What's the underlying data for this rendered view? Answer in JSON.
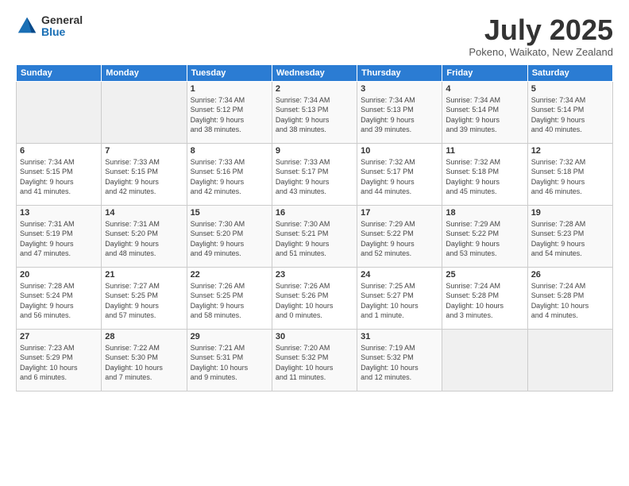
{
  "logo": {
    "general": "General",
    "blue": "Blue"
  },
  "title": "July 2025",
  "subtitle": "Pokeno, Waikato, New Zealand",
  "days_header": [
    "Sunday",
    "Monday",
    "Tuesday",
    "Wednesday",
    "Thursday",
    "Friday",
    "Saturday"
  ],
  "weeks": [
    [
      {
        "day": "",
        "info": ""
      },
      {
        "day": "",
        "info": ""
      },
      {
        "day": "1",
        "info": "Sunrise: 7:34 AM\nSunset: 5:12 PM\nDaylight: 9 hours\nand 38 minutes."
      },
      {
        "day": "2",
        "info": "Sunrise: 7:34 AM\nSunset: 5:13 PM\nDaylight: 9 hours\nand 38 minutes."
      },
      {
        "day": "3",
        "info": "Sunrise: 7:34 AM\nSunset: 5:13 PM\nDaylight: 9 hours\nand 39 minutes."
      },
      {
        "day": "4",
        "info": "Sunrise: 7:34 AM\nSunset: 5:14 PM\nDaylight: 9 hours\nand 39 minutes."
      },
      {
        "day": "5",
        "info": "Sunrise: 7:34 AM\nSunset: 5:14 PM\nDaylight: 9 hours\nand 40 minutes."
      }
    ],
    [
      {
        "day": "6",
        "info": "Sunrise: 7:34 AM\nSunset: 5:15 PM\nDaylight: 9 hours\nand 41 minutes."
      },
      {
        "day": "7",
        "info": "Sunrise: 7:33 AM\nSunset: 5:15 PM\nDaylight: 9 hours\nand 42 minutes."
      },
      {
        "day": "8",
        "info": "Sunrise: 7:33 AM\nSunset: 5:16 PM\nDaylight: 9 hours\nand 42 minutes."
      },
      {
        "day": "9",
        "info": "Sunrise: 7:33 AM\nSunset: 5:17 PM\nDaylight: 9 hours\nand 43 minutes."
      },
      {
        "day": "10",
        "info": "Sunrise: 7:32 AM\nSunset: 5:17 PM\nDaylight: 9 hours\nand 44 minutes."
      },
      {
        "day": "11",
        "info": "Sunrise: 7:32 AM\nSunset: 5:18 PM\nDaylight: 9 hours\nand 45 minutes."
      },
      {
        "day": "12",
        "info": "Sunrise: 7:32 AM\nSunset: 5:18 PM\nDaylight: 9 hours\nand 46 minutes."
      }
    ],
    [
      {
        "day": "13",
        "info": "Sunrise: 7:31 AM\nSunset: 5:19 PM\nDaylight: 9 hours\nand 47 minutes."
      },
      {
        "day": "14",
        "info": "Sunrise: 7:31 AM\nSunset: 5:20 PM\nDaylight: 9 hours\nand 48 minutes."
      },
      {
        "day": "15",
        "info": "Sunrise: 7:30 AM\nSunset: 5:20 PM\nDaylight: 9 hours\nand 49 minutes."
      },
      {
        "day": "16",
        "info": "Sunrise: 7:30 AM\nSunset: 5:21 PM\nDaylight: 9 hours\nand 51 minutes."
      },
      {
        "day": "17",
        "info": "Sunrise: 7:29 AM\nSunset: 5:22 PM\nDaylight: 9 hours\nand 52 minutes."
      },
      {
        "day": "18",
        "info": "Sunrise: 7:29 AM\nSunset: 5:22 PM\nDaylight: 9 hours\nand 53 minutes."
      },
      {
        "day": "19",
        "info": "Sunrise: 7:28 AM\nSunset: 5:23 PM\nDaylight: 9 hours\nand 54 minutes."
      }
    ],
    [
      {
        "day": "20",
        "info": "Sunrise: 7:28 AM\nSunset: 5:24 PM\nDaylight: 9 hours\nand 56 minutes."
      },
      {
        "day": "21",
        "info": "Sunrise: 7:27 AM\nSunset: 5:25 PM\nDaylight: 9 hours\nand 57 minutes."
      },
      {
        "day": "22",
        "info": "Sunrise: 7:26 AM\nSunset: 5:25 PM\nDaylight: 9 hours\nand 58 minutes."
      },
      {
        "day": "23",
        "info": "Sunrise: 7:26 AM\nSunset: 5:26 PM\nDaylight: 10 hours\nand 0 minutes."
      },
      {
        "day": "24",
        "info": "Sunrise: 7:25 AM\nSunset: 5:27 PM\nDaylight: 10 hours\nand 1 minute."
      },
      {
        "day": "25",
        "info": "Sunrise: 7:24 AM\nSunset: 5:28 PM\nDaylight: 10 hours\nand 3 minutes."
      },
      {
        "day": "26",
        "info": "Sunrise: 7:24 AM\nSunset: 5:28 PM\nDaylight: 10 hours\nand 4 minutes."
      }
    ],
    [
      {
        "day": "27",
        "info": "Sunrise: 7:23 AM\nSunset: 5:29 PM\nDaylight: 10 hours\nand 6 minutes."
      },
      {
        "day": "28",
        "info": "Sunrise: 7:22 AM\nSunset: 5:30 PM\nDaylight: 10 hours\nand 7 minutes."
      },
      {
        "day": "29",
        "info": "Sunrise: 7:21 AM\nSunset: 5:31 PM\nDaylight: 10 hours\nand 9 minutes."
      },
      {
        "day": "30",
        "info": "Sunrise: 7:20 AM\nSunset: 5:32 PM\nDaylight: 10 hours\nand 11 minutes."
      },
      {
        "day": "31",
        "info": "Sunrise: 7:19 AM\nSunset: 5:32 PM\nDaylight: 10 hours\nand 12 minutes."
      },
      {
        "day": "",
        "info": ""
      },
      {
        "day": "",
        "info": ""
      }
    ]
  ]
}
